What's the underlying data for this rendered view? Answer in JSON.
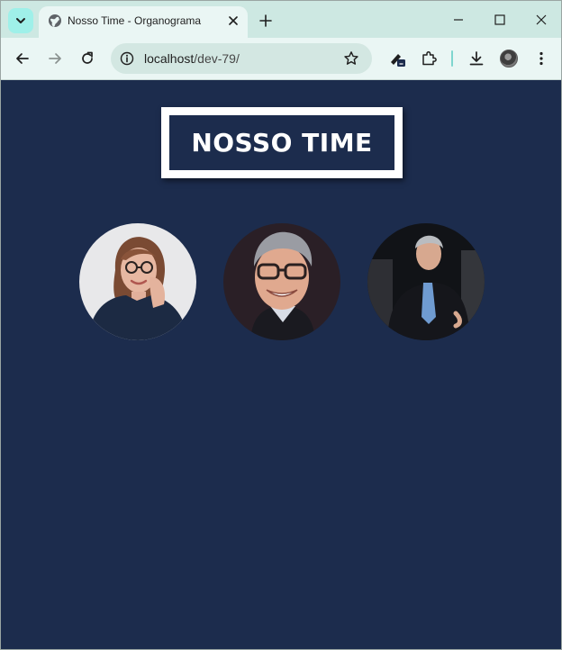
{
  "browser": {
    "tab": {
      "title": "Nosso Time - Organograma"
    },
    "address_bar": {
      "host": "localhost",
      "path": "/dev-79/"
    }
  },
  "icons": {
    "tab_search": "chevron-down-icon",
    "favicon": "globe-icon",
    "tab_close": "close-icon",
    "new_tab": "plus-icon",
    "back": "arrow-left-icon",
    "forward": "arrow-right-icon",
    "reload": "reload-icon",
    "site_info": "info-icon",
    "bookmark": "star-icon",
    "extension_action": "pen-icon",
    "extensions": "puzzle-icon",
    "downloads": "download-icon",
    "profile": "avatar",
    "menu": "kebab-menu-icon"
  },
  "page": {
    "heading": "NOSSO TIME",
    "members": [
      {
        "photo": "woman-glasses-portrait"
      },
      {
        "photo": "man-glasses-portrait"
      },
      {
        "photo": "man-suit-portrait"
      }
    ]
  },
  "colors": {
    "page_background": "#1c2c4d",
    "heading_frame": "#ffffff",
    "tabstrip": "#cde8e2",
    "toolbar": "#eaf6f4"
  }
}
